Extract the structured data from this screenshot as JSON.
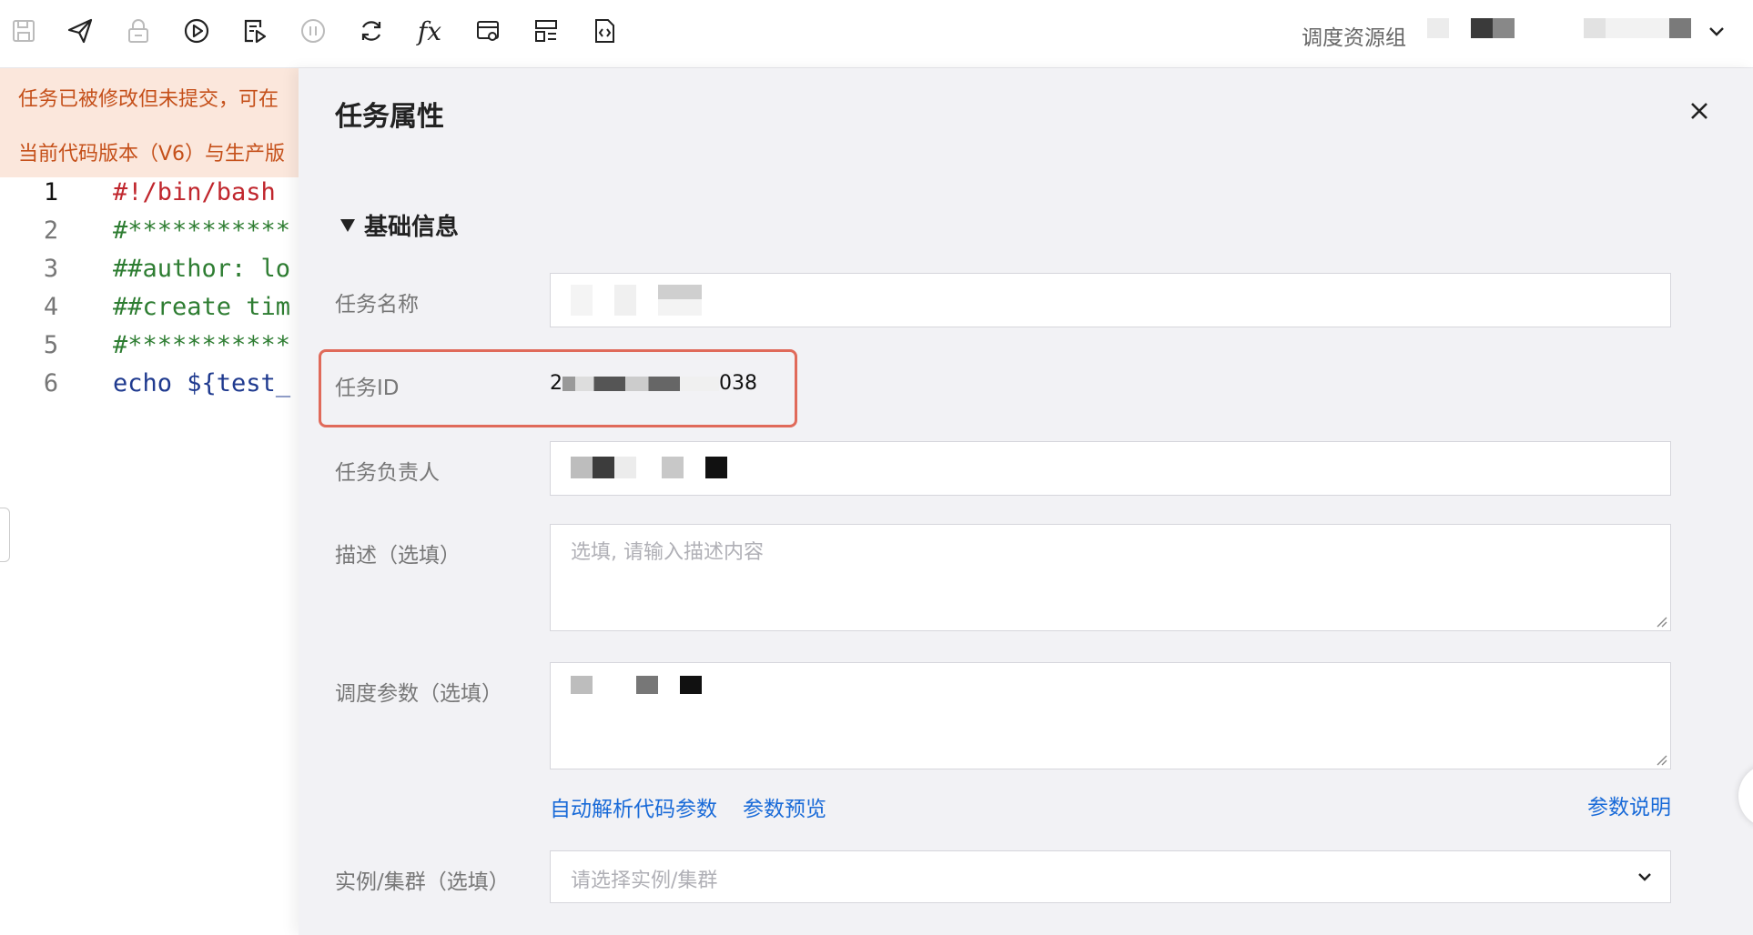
{
  "toolbar": {
    "icons": [
      "save-icon",
      "submit-icon",
      "lock-icon",
      "run-icon",
      "run-selected-icon",
      "stop-icon",
      "refresh-icon",
      "function-icon",
      "format-icon",
      "layout-icon",
      "code-file-icon"
    ],
    "fx_label": "fx",
    "resource_group_label": "调度资源组"
  },
  "banner": {
    "line1": "任务已被修改但未提交，可在",
    "line2": "当前代码版本（V6）与生产版"
  },
  "editor": {
    "lines": [
      {
        "num": "1",
        "text": "#!/bin/bash"
      },
      {
        "num": "2",
        "text": "#***********"
      },
      {
        "num": "3",
        "text": "##author: lo"
      },
      {
        "num": "4",
        "text": "##create tim"
      },
      {
        "num": "5",
        "text": "#***********"
      },
      {
        "num": "6",
        "text_a": "echo ",
        "text_b": "${test_"
      }
    ]
  },
  "panel": {
    "title": "任务属性",
    "section": "基础信息",
    "fields": {
      "name_label": "任务名称",
      "id_label": "任务ID",
      "id_value_prefix": "2",
      "id_value_suffix": "038",
      "owner_label": "任务负责人",
      "desc_label": "描述（选填）",
      "desc_placeholder": "选填, 请输入描述内容",
      "params_label": "调度参数（选填）",
      "instance_label": "实例/集群（选填）",
      "instance_placeholder": "请选择实例/集群"
    },
    "links": {
      "auto_parse": "自动解析代码参数",
      "preview": "参数预览",
      "help": "参数说明"
    }
  },
  "colors": {
    "accent": "#1a6bd8",
    "warning_bg": "#fbe7dc",
    "warning_text": "#c5501a",
    "highlight": "#e06a5a"
  }
}
